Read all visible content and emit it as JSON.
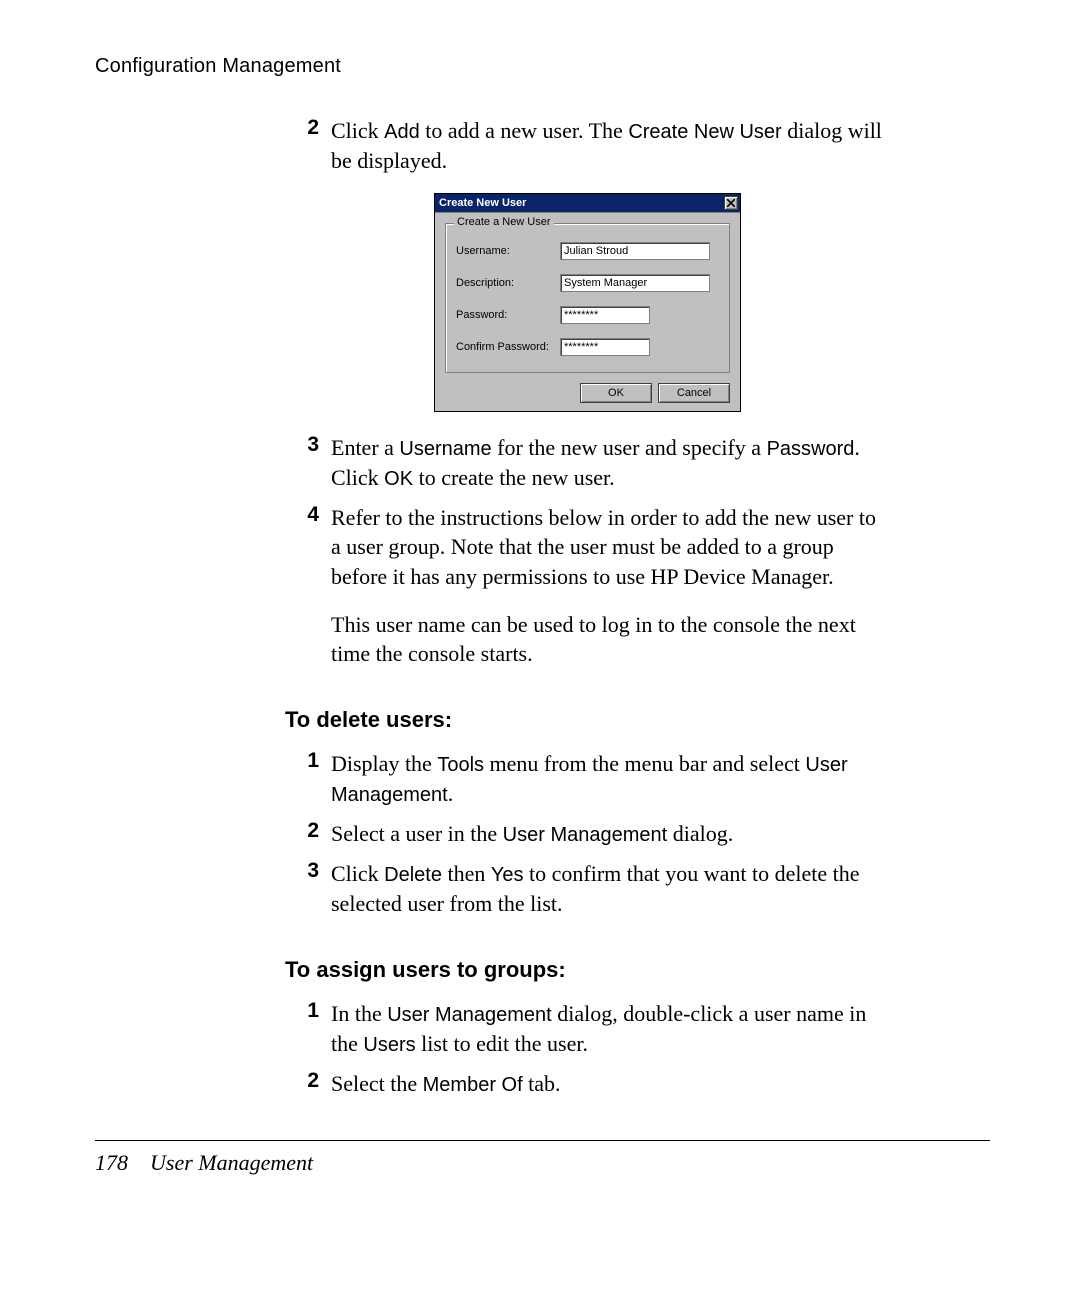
{
  "header": {
    "title": "Configuration Management"
  },
  "dialog": {
    "title": "Create New User",
    "group_legend": "Create a New User",
    "labels": {
      "username": "Username:",
      "description": "Description:",
      "password": "Password:",
      "confirm": "Confirm Password:"
    },
    "values": {
      "username": "Julian Stroud",
      "description": "System Manager",
      "password": "********",
      "confirm": "********"
    },
    "buttons": {
      "ok": "OK",
      "cancel": "Cancel"
    }
  },
  "steps_top": {
    "s2": {
      "num": "2",
      "pre": "Click ",
      "ui1": "Add",
      "mid": " to add a new user. The ",
      "ui2": "Create New User",
      "post": " dialog will be displayed."
    },
    "s3": {
      "num": "3",
      "pre": "Enter a ",
      "ui1": "Username",
      "mid1": " for the new user and specify a ",
      "ui2": "Password",
      "mid2": ". Click ",
      "ui3": "OK",
      "post": " to create the new user."
    },
    "s4": {
      "num": "4",
      "text": "Refer to the instructions below in order to add the new user to a user group. Note that the user must be added to a group before it has any permissions to use HP Device Manager."
    },
    "after4": "This user name can be used to log in to the console the next time the console starts."
  },
  "section_delete": {
    "heading": "To delete users:",
    "s1": {
      "num": "1",
      "pre": "Display the ",
      "ui1": "Tools",
      "mid": " menu from the menu bar and select ",
      "ui2": "User Management",
      "post": "."
    },
    "s2": {
      "num": "2",
      "pre": "Select a user in the ",
      "ui1": "User Management",
      "post": " dialog."
    },
    "s3": {
      "num": "3",
      "pre": "Click ",
      "ui1": "Delete",
      "mid": " then ",
      "ui2": "Yes",
      "post": " to confirm that you want to delete the selected user from the list."
    }
  },
  "section_assign": {
    "heading": "To assign users to groups:",
    "s1": {
      "num": "1",
      "pre": "In the ",
      "ui1": "User Management",
      "mid": " dialog, double-click a user name in the ",
      "ui2": "Users",
      "post": " list to edit the user."
    },
    "s2": {
      "num": "2",
      "pre": "Select the ",
      "ui1": "Member Of",
      "post": " tab."
    }
  },
  "footer": {
    "page_number": "178",
    "chapter": "User Management"
  }
}
